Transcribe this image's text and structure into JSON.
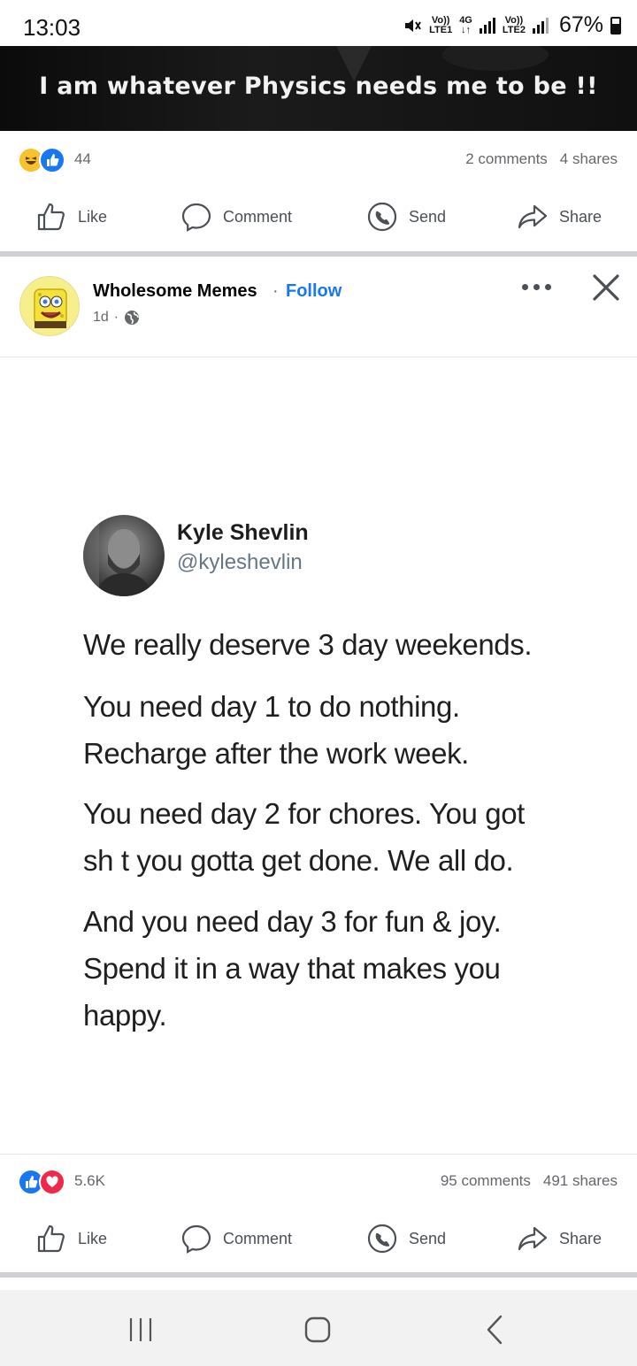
{
  "status_bar": {
    "time": "13:03",
    "sim1_top": "Vo))",
    "sim1_bottom": "LTE1",
    "net_top": "4G",
    "net_bottom": "↓↑",
    "sim2_top": "Vo))",
    "sim2_bottom": "LTE2",
    "battery": "67%"
  },
  "previous_post": {
    "image_caption": "I am whatever Physics needs me to be !!",
    "reaction_count": "44",
    "comments": "2 comments",
    "shares": "4 shares",
    "reactions": [
      "haha",
      "like"
    ]
  },
  "actions": {
    "like": "Like",
    "comment": "Comment",
    "send": "Send",
    "share": "Share"
  },
  "post": {
    "page_name": "Wholesome Memes",
    "separator": "·",
    "follow": "Follow",
    "time": "1d",
    "meta_separator": "·",
    "privacy_icon": "globe-icon",
    "reaction_count": "5.6K",
    "comments": "95 comments",
    "shares": "491 shares",
    "reactions": [
      "like",
      "love"
    ]
  },
  "tweet": {
    "name": "Kyle Shevlin",
    "handle": "@kyleshevlin",
    "paragraphs": [
      [
        "We really deserve 3 day weekends."
      ],
      [
        "You need day 1 to do nothing.",
        "Recharge after the work week."
      ],
      [
        "You need day 2 for chores. You got",
        "sh t you gotta get done. We all do."
      ],
      [
        "And you need day 3 for fun & joy.",
        "Spend it in a way that makes you",
        "happy."
      ]
    ]
  },
  "colors": {
    "brand_blue": "#1877f2",
    "love_red": "#f02849",
    "haha_yellow": "#f7c22c",
    "secondary_text": "#65676b"
  }
}
